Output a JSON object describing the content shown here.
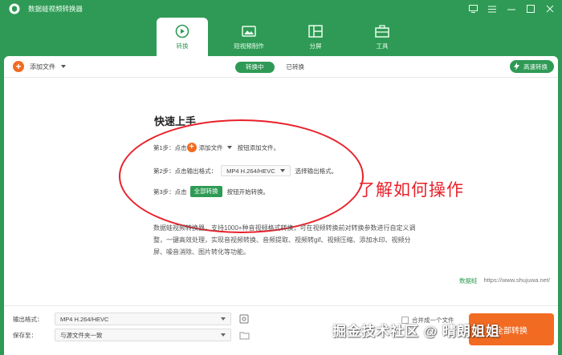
{
  "app": {
    "title": "数据蛙视频转换器"
  },
  "window_controls": [
    "window-mode-icon",
    "menu-icon",
    "minimize-icon",
    "maximize-icon",
    "close-icon"
  ],
  "main_tabs": [
    {
      "label": "转换",
      "icon": "convert-icon",
      "active": true
    },
    {
      "label": "短视频制作",
      "icon": "short-video-icon",
      "active": false
    },
    {
      "label": "分屏",
      "icon": "split-screen-icon",
      "active": false
    },
    {
      "label": "工具",
      "icon": "toolbox-icon",
      "active": false
    }
  ],
  "toolbar": {
    "add_file": "添加文件",
    "sub_tabs": [
      {
        "label": "转换中",
        "active": true
      },
      {
        "label": "已转换",
        "active": false
      }
    ],
    "fast_convert": "高速转换"
  },
  "quick_start": {
    "title": "快速上手",
    "step1": {
      "prefix": "第1步：点击",
      "button": "添加文件",
      "suffix": "按钮添加文件。"
    },
    "step2": {
      "prefix": "第2步：点击输出格式：",
      "format": "MP4 H.264/HEVC",
      "suffix": "选择输出格式。"
    },
    "step3": {
      "prefix": "第3步：点击",
      "button": "全部转换",
      "suffix": "按钮开始转换。"
    }
  },
  "annotation": "了解如何操作",
  "description": "数据蛙视频转换器，支持1000+种音视频格式转换，可在视频转换前对转换参数进行自定义调整，一键高效处理，实现音视频转换、音频提取、视频转gif、视频压缩、添加水印、视频分屏、噪音消除、图片转化等功能。",
  "brand": {
    "name": "数据蛙",
    "url": "https://www.shujuwa.net/"
  },
  "bottom": {
    "format_label": "输出格式：",
    "format_value": "MP4 H.264/HEVC",
    "save_label": "保存至：",
    "save_value": "与源文件夹一致",
    "merge_label": "合并成一个文件",
    "convert_all": "全部转换"
  },
  "watermark": "掘金技术社区 @ 晴朗姐姐",
  "colors": {
    "brand_green": "#2f9a55",
    "accent_orange": "#f26b22",
    "annotation_red": "#e8212a"
  }
}
